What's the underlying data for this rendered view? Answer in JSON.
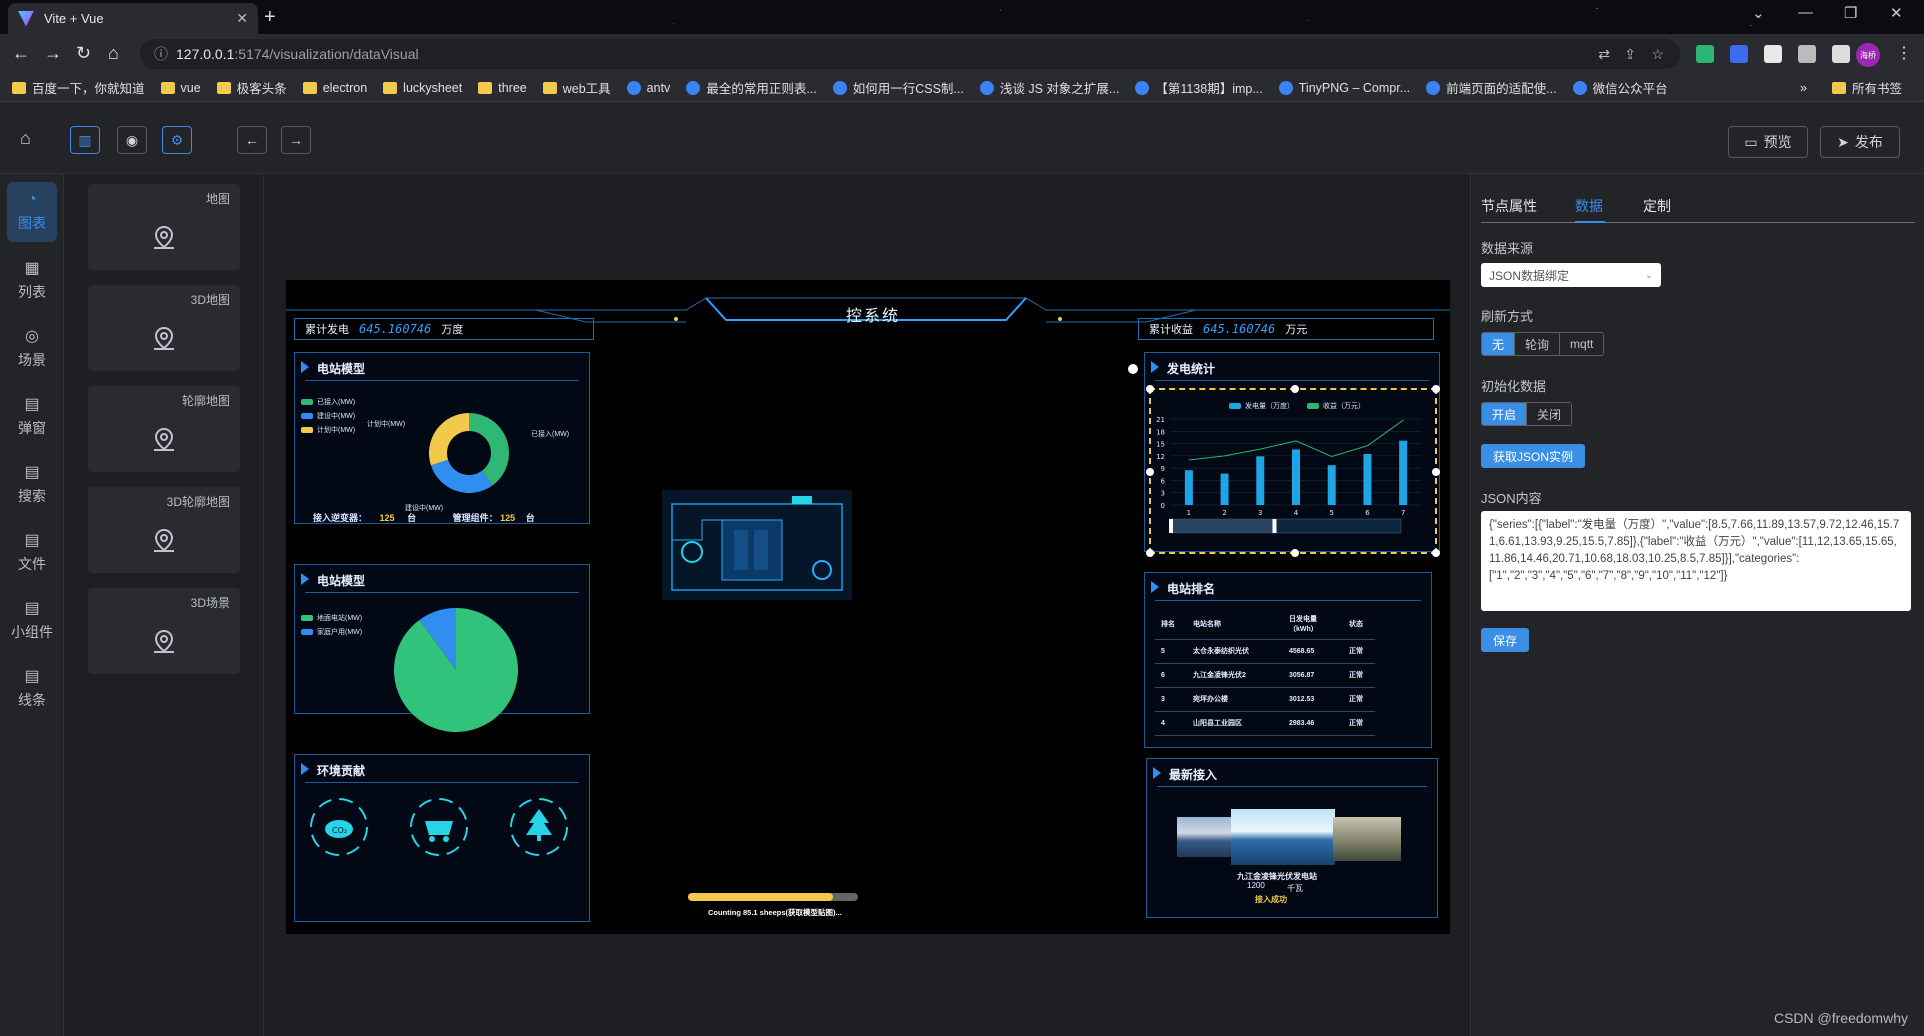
{
  "browser": {
    "tab_title": "Vite + Vue",
    "url_host": "127.0.0.1",
    "url_path": ":5174/visualization/dataVisual",
    "profile_label": "海桥",
    "bookmarks": [
      "百度一下，你就知道",
      "vue",
      "极客头条",
      "electron",
      "luckysheet",
      "three",
      "web工具",
      "antv",
      "最全的常用正则表...",
      "如何用一行CSS制...",
      "浅谈 JS 对象之扩展...",
      "【第1138期】imp...",
      "TinyPNG – Compr...",
      "前端页面的适配使...",
      "微信公众平台"
    ],
    "bookmarks_more": "»",
    "all_bookmarks": "所有书签"
  },
  "header": {
    "preview": "预览",
    "publish": "发布"
  },
  "leftnav": [
    {
      "label": "图表",
      "icon": "chart-icon"
    },
    {
      "label": "列表",
      "icon": "table-icon"
    },
    {
      "label": "场景",
      "icon": "scene-icon"
    },
    {
      "label": "弹窗",
      "icon": "popup-icon"
    },
    {
      "label": "搜索",
      "icon": "search-icon"
    },
    {
      "label": "文件",
      "icon": "file-icon"
    },
    {
      "label": "小组件",
      "icon": "widget-icon"
    },
    {
      "label": "线条",
      "icon": "line-icon"
    }
  ],
  "components": [
    "地图",
    "3D地图",
    "轮廓地图",
    "3D轮廓地图",
    "3D场景"
  ],
  "screen": {
    "title": "控系统",
    "left_top": {
      "label": "累计发电",
      "value": "645.160746",
      "unit": "万度"
    },
    "right_top": {
      "label": "累计收益",
      "value": "645.160746",
      "unit": "万元"
    },
    "panel1": {
      "title": "电站模型",
      "legend": [
        "已接入(MW)",
        "建设中(MW)",
        "计划中(MW)"
      ],
      "labels": [
        "计划中(MW)",
        "已接入(MW)",
        "建设中(MW)"
      ],
      "footer_a_label": "接入逆变器：",
      "footer_a_value": "125",
      "footer_a_unit": "台",
      "footer_b_label": "管理组件：",
      "footer_b_value": "125",
      "footer_b_unit": "台"
    },
    "panel2": {
      "title": "电站模型",
      "legend": [
        "地面电站(MW)",
        "家庭户用(MW)"
      ]
    },
    "panel3": {
      "title": "环境贡献",
      "icons": [
        "co2-icon",
        "coal-cart-icon",
        "tree-icon"
      ]
    },
    "panel4": {
      "title": "发电统计",
      "legend": [
        "发电量（万度）",
        "收益（万元）"
      ]
    },
    "panel5": {
      "title": "电站排名",
      "headers": [
        "排名",
        "电站名称",
        "日发电量（kWh）",
        "状态"
      ],
      "rows": [
        [
          "5",
          "太仓永泰纺织光伏",
          "4568.65",
          "正常"
        ],
        [
          "6",
          "九江金凌锋光伏2",
          "3056.87",
          "正常"
        ],
        [
          "3",
          "宛坪办公楼",
          "3012.53",
          "正常"
        ],
        [
          "4",
          "山阳县工业园区",
          "2983.46",
          "正常"
        ]
      ]
    },
    "panel6": {
      "title": "最新接入",
      "station": "九江金凌锋光伏发电站",
      "capacity": "1200",
      "capacity_unit": "千瓦",
      "status": "接入成功"
    },
    "loading": {
      "text": "Counting 85.1 sheeps(获取模型贴图)...",
      "progress": 0.85
    }
  },
  "chart_data": [
    {
      "type": "bar+line",
      "categories": [
        "1",
        "2",
        "3",
        "4",
        "5",
        "6",
        "7"
      ],
      "series": [
        {
          "name": "发电量（万度）",
          "values": [
            8.5,
            7.66,
            11.89,
            13.57,
            9.72,
            12.46,
            15.71
          ]
        },
        {
          "name": "收益（万元）",
          "values": [
            11,
            12,
            13.65,
            15.65,
            11.86,
            14.46,
            20.71
          ]
        }
      ],
      "ylim": [
        0,
        21
      ],
      "yticks": [
        0,
        3,
        6,
        9,
        12,
        15,
        18,
        21
      ],
      "colors": [
        "#1fa4e4",
        "#2bb673"
      ]
    },
    {
      "type": "pie",
      "slices": [
        {
          "name": "已接入(MW)",
          "value": 40,
          "color": "#2fb873"
        },
        {
          "name": "建设中(MW)",
          "value": 30,
          "color": "#2f8ef0"
        },
        {
          "name": "计划中(MW)",
          "value": 30,
          "color": "#f2c94c"
        }
      ]
    },
    {
      "type": "pie",
      "slices": [
        {
          "name": "地面电站(MW)",
          "value": 90,
          "color": "#31c37c"
        },
        {
          "name": "家庭户用(MW)",
          "value": 10,
          "color": "#2f8ef0"
        }
      ]
    }
  ],
  "rightpanel": {
    "tabs": [
      "节点属性",
      "数据",
      "定制"
    ],
    "source_label": "数据来源",
    "source_value": "JSON数据绑定",
    "refresh_label": "刷新方式",
    "refresh_options": [
      "无",
      "轮询",
      "mqtt"
    ],
    "init_label": "初始化数据",
    "init_options": [
      "开启",
      "关闭"
    ],
    "get_json": "获取JSON实例",
    "json_label": "JSON内容",
    "json_text": "{\"series\":[{\"label\":\"发电量（万度）\",\"value\":[8.5,7.66,11.89,13.57,9.72,12.46,15.71,6.61,13.93,9.25,15.5,7.85]},{\"label\":\"收益（万元）\",\"value\":[11,12,13.65,15.65,11.86,14.46,20.71,10.68,18.03,10.25,8.5,7.85]}],\"categories\":[\"1\",\"2\",\"3\",\"4\",\"5\",\"6\",\"7\",\"8\",\"9\",\"10\",\"11\",\"12\"]}",
    "save": "保存"
  },
  "watermark": "CSDN @freedomwhy"
}
